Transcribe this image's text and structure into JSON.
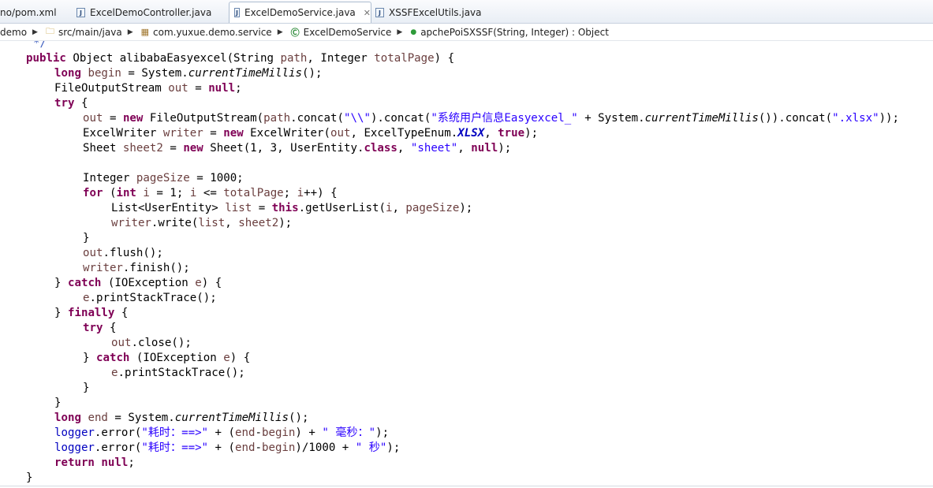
{
  "tabs": [
    {
      "label": "no/pom.xml"
    },
    {
      "label": "ExcelDemoController.java"
    },
    {
      "label": "ExcelDemoService.java"
    },
    {
      "label": "XSSFExcelUtils.java"
    }
  ],
  "breadcrumb": {
    "project": "demo",
    "source_folder": "src/main/java",
    "package": "com.yuxue.demo.service",
    "class": "ExcelDemoService",
    "method": "apchePoiSXSSF(String, Integer) : Object"
  },
  "code": {
    "comment_end": "*/",
    "sig_public": "public",
    "sig_rest_a": " Object alibabaEasyexcel(String ",
    "sig_p1": "path",
    "sig_rest_b": ", Integer ",
    "sig_p2": "totalPage",
    "sig_rest_c": ") {",
    "s1": "\"\\\\\"",
    "s2": "\"系统用户信息Easyexcel_\"",
    "s3": "\".xlsx\"",
    "s4": "\"sheet\"",
    "s5": "\"耗时：==>\"",
    "s6": "\" 毫秒：\"",
    "s7": "\"耗时：==>\"",
    "s8": "\" 秒\"",
    "enum_const": "XLSX",
    "method_ctm": "currentTimeMillis"
  }
}
